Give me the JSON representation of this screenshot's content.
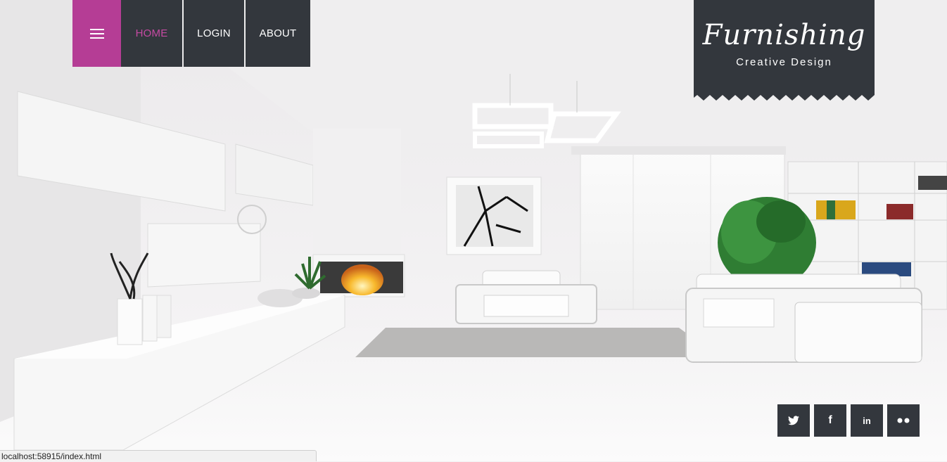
{
  "nav": {
    "menu_icon": "hamburger-icon",
    "items": [
      {
        "label": "HOME",
        "active": true
      },
      {
        "label": "LOGIN",
        "active": false
      },
      {
        "label": "ABOUT",
        "active": false
      }
    ]
  },
  "logo": {
    "title": "Furnishing",
    "tagline": "Creative Design"
  },
  "social": [
    {
      "icon": "twitter-icon",
      "glyph": "🐦"
    },
    {
      "icon": "facebook-icon",
      "glyph": "f"
    },
    {
      "icon": "linkedin-icon",
      "glyph": "in"
    },
    {
      "icon": "flickr-icon",
      "glyph": "●●"
    }
  ],
  "status_bar": {
    "url": "localhost:58915/index.html"
  },
  "colors": {
    "accent": "#b53d95",
    "active_text": "#c64aa3",
    "panel": "#33373d"
  }
}
